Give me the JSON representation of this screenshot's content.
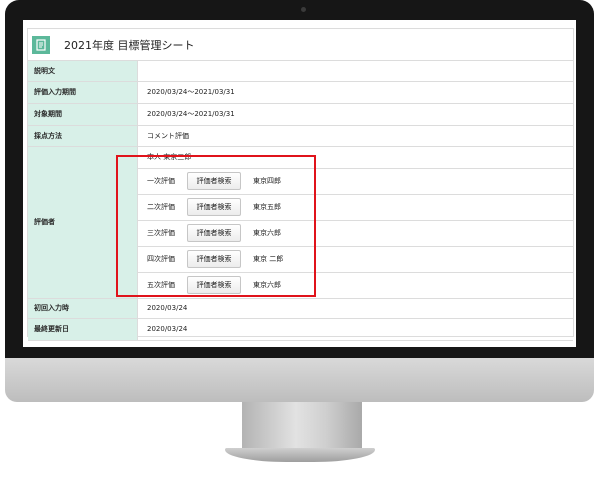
{
  "sheet": {
    "title": "2021年度 目標管理シート",
    "rows": {
      "description": {
        "label": "説明文",
        "value": ""
      },
      "input_period": {
        "label": "評価入力期間",
        "value": "2020/03/24～2021/03/31"
      },
      "target_period": {
        "label": "対象期間",
        "value": "2020/03/24～2021/03/31"
      },
      "scoring": {
        "label": "採点方法",
        "value": "コメント評価"
      },
      "evaluators": {
        "label": "評価者",
        "self": "本人 東京三郎",
        "search_button_label": "評価者検索",
        "levels": [
          {
            "rank": "一次評価",
            "name": "東京四郎"
          },
          {
            "rank": "二次評価",
            "name": "東京五郎"
          },
          {
            "rank": "三次評価",
            "name": "東京六郎"
          },
          {
            "rank": "四次評価",
            "name": "東京 二郎"
          },
          {
            "rank": "五次評価",
            "name": "東京六郎"
          }
        ]
      },
      "first_input": {
        "label": "初回入力時",
        "value": "2020/03/24"
      },
      "last_updated": {
        "label": "最終更新日",
        "value": "2020/03/24"
      }
    }
  },
  "colors": {
    "label_bg": "#d8f0e8",
    "icon_green": "#5cb89a",
    "highlight_red": "#e0131b",
    "bezel": "#161616"
  }
}
